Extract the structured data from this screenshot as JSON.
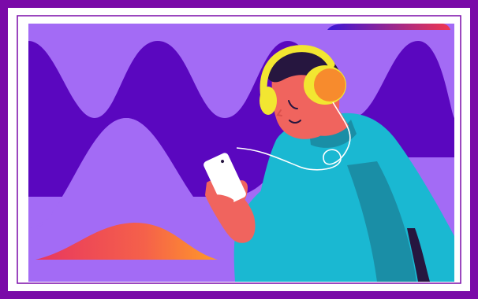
{
  "image": {
    "subject": "illustration",
    "colors": {
      "frame": "#7a0aa8",
      "mat": "#ffffff",
      "background": "#a36bf5",
      "wave": "#5a07bf",
      "skin": "#f0645e",
      "hair": "#26163f",
      "headphones_band": "#f2e631",
      "headphones_cup": "#f78b2d",
      "sweater": "#1ab8d2",
      "sweater_shadow": "#1a8ea6",
      "phone": "#ffffff",
      "gradient_start": "#e8365f",
      "gradient_end": "#ff9a28",
      "top_bar_start": "#3a16d6",
      "top_bar_end": "#f0374f"
    },
    "icons": [
      "headphones-icon",
      "phone-icon"
    ]
  }
}
